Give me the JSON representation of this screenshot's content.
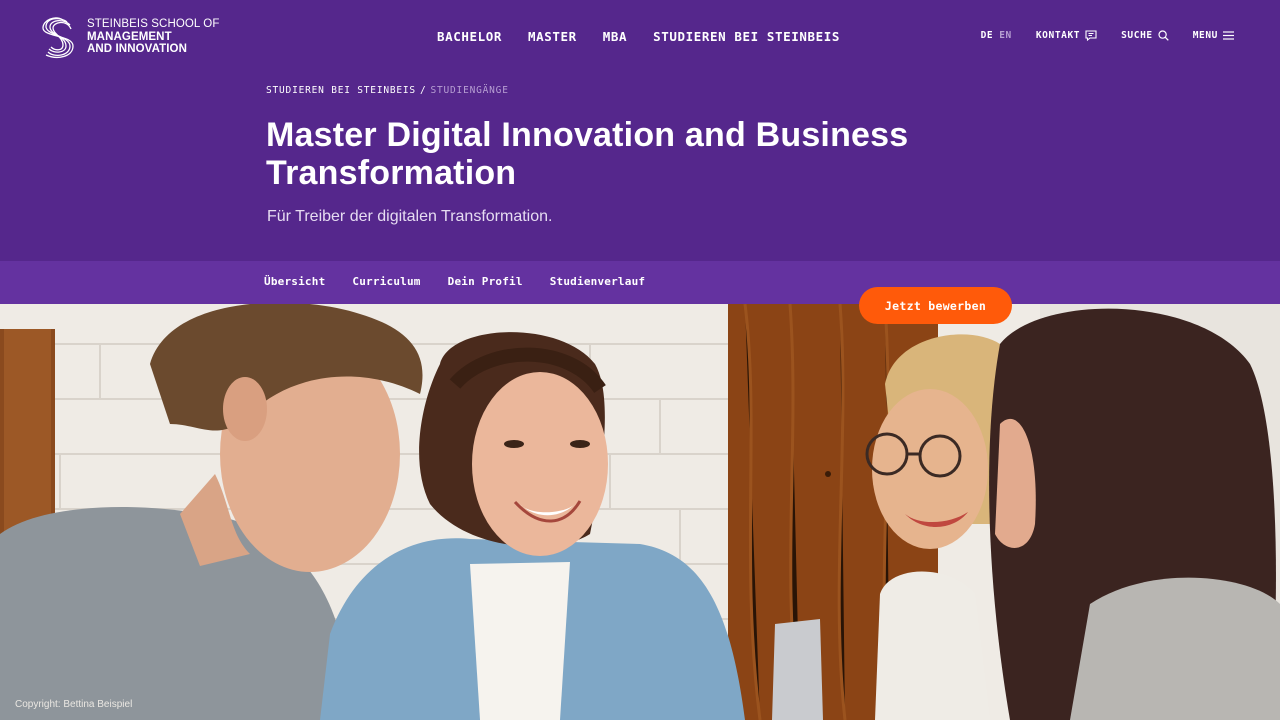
{
  "brand": {
    "line1": "STEINBEIS SCHOOL OF",
    "line2": "MANAGEMENT",
    "line3": "AND INNOVATION"
  },
  "main_nav": [
    {
      "label": "BACHELOR"
    },
    {
      "label": "MASTER"
    },
    {
      "label": "MBA"
    },
    {
      "label": "STUDIEREN BEI STEINBEIS"
    }
  ],
  "utility_nav": {
    "lang_active": "DE",
    "lang_inactive": "EN",
    "contact_label": "KONTAKT",
    "search_label": "SUCHE",
    "menu_label": "MENU"
  },
  "breadcrumb": {
    "parent": "STUDIEREN BEI STEINBEIS",
    "separator": "/",
    "current": "STUDIENGÄNGE"
  },
  "hero": {
    "title": "Master Digital Innovation and Business Transformation",
    "subtitle": "Für Treiber der digitalen Transformation."
  },
  "sub_nav": [
    {
      "label": "Übersicht"
    },
    {
      "label": "Curriculum"
    },
    {
      "label": "Dein Profil"
    },
    {
      "label": "Studienverlauf"
    }
  ],
  "cta": {
    "label": "Jetzt bewerben"
  },
  "photo": {
    "copyright": "Copyright: Bettina Beispiel"
  },
  "colors": {
    "brand_purple": "#55278c",
    "subnav_purple": "#6432a0",
    "cta_orange": "#ff5a0a"
  },
  "icons": [
    "logo-mark-icon",
    "chat-icon",
    "search-icon",
    "menu-icon"
  ]
}
